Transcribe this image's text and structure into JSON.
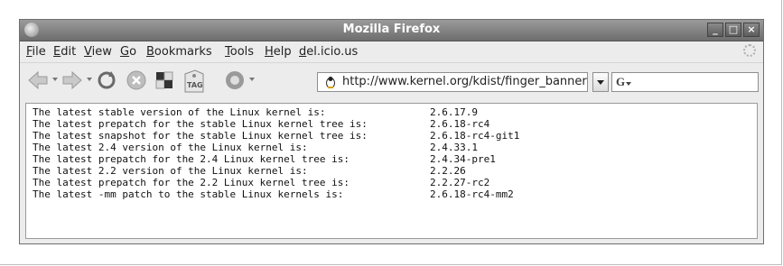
{
  "window": {
    "title": "Mozilla Firefox",
    "controls": {
      "minimize": "_",
      "maximize": "□",
      "close": "×"
    }
  },
  "menubar": {
    "items": [
      {
        "label": "File"
      },
      {
        "label": "Edit"
      },
      {
        "label": "View"
      },
      {
        "label": "Go"
      },
      {
        "label": "Bookmarks"
      },
      {
        "label": "Tools"
      },
      {
        "label": "Help"
      },
      {
        "label": "del.icio.us"
      }
    ]
  },
  "toolbar": {
    "icons": [
      "back-icon",
      "forward-icon",
      "reload-icon",
      "stop-icon",
      "home-icon",
      "tag-icon",
      "delicious-icon"
    ],
    "tag_label": "TAG",
    "url": "http://www.kernel.org/kdist/finger_banner",
    "search_engine_icon": "google-icon",
    "search_value": ""
  },
  "content": {
    "lines": [
      {
        "label": "The latest stable version of the Linux kernel is:",
        "value": "2.6.17.9"
      },
      {
        "label": "The latest prepatch for the stable Linux kernel tree is:",
        "value": "2.6.18-rc4"
      },
      {
        "label": "The latest snapshot for the stable Linux kernel tree is:",
        "value": "2.6.18-rc4-git1"
      },
      {
        "label": "The latest 2.4 version of the Linux kernel is:",
        "value": "2.4.33.1"
      },
      {
        "label": "The latest prepatch for the 2.4 Linux kernel tree is:",
        "value": "2.4.34-pre1"
      },
      {
        "label": "The latest 2.2 version of the Linux kernel is:",
        "value": "2.2.26"
      },
      {
        "label": "The latest prepatch for the 2.2 Linux kernel tree is:",
        "value": "2.2.27-rc2"
      },
      {
        "label": "The latest -mm patch to the stable Linux kernels is:",
        "value": "2.6.18-rc4-mm2"
      }
    ]
  }
}
